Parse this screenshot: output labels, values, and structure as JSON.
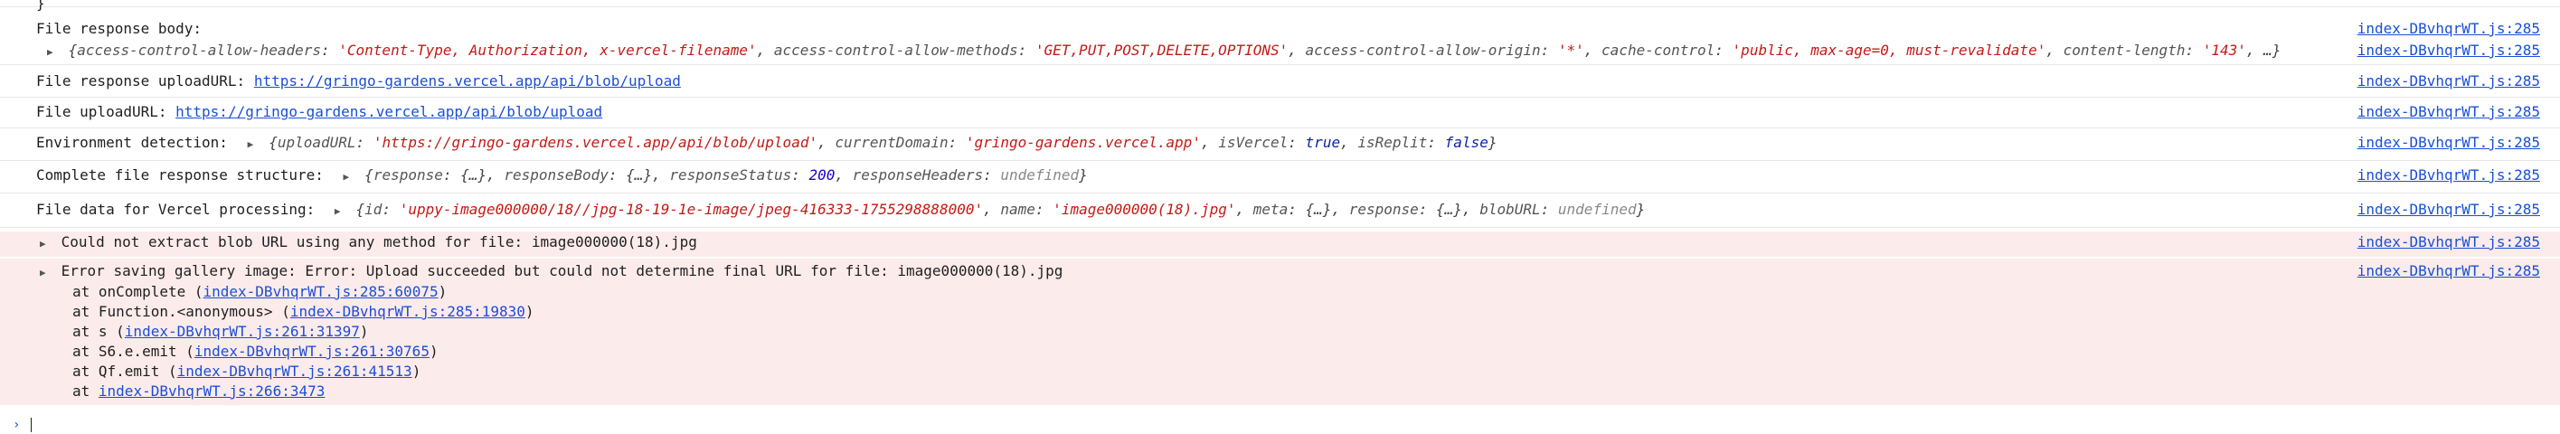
{
  "top_fragment": "}",
  "source_ref": "index-DBvhqrWT.js:285",
  "rows": {
    "file_response_body": {
      "label": "File response body:",
      "object": {
        "k1": "access-control-allow-headers",
        "v1": "'Content-Type, Authorization, x-vercel-filename'",
        "k2": "access-control-allow-methods",
        "v2": "'GET,PUT,POST,DELETE,OPTIONS'",
        "k3": "access-control-allow-origin",
        "v3": "'*'",
        "k4": "cache-control",
        "v4": "'public, max-age=0, must-revalidate'",
        "k5": "content-length",
        "v5": "'143'",
        "tail": ", …}"
      }
    },
    "file_response_upload_url": {
      "label": "File response uploadURL:",
      "url": "https://gringo-gardens.vercel.app/api/blob/upload"
    },
    "file_upload_url": {
      "label": "File uploadURL:",
      "url": "https://gringo-gardens.vercel.app/api/blob/upload"
    },
    "environment_detection": {
      "label": "Environment detection:",
      "k1": "uploadURL",
      "v1": "'https://gringo-gardens.vercel.app/api/blob/upload'",
      "k2": "currentDomain",
      "v2": "'gringo-gardens.vercel.app'",
      "k3": "isVercel",
      "v3": "true",
      "k4": "isReplit",
      "v4": "false"
    },
    "complete_structure": {
      "label": "Complete file response structure:",
      "k1": "response",
      "v1": "{…}",
      "k2": "responseBody",
      "v2": "{…}",
      "k3": "responseStatus",
      "v3": "200",
      "k4": "responseHeaders",
      "v4": "undefined"
    },
    "vercel_processing": {
      "label": "File data for Vercel processing:",
      "k1": "id",
      "v1": "'uppy-image000000/18//jpg-18-19-1e-image/jpeg-416333-1755298888000'",
      "k2": "name",
      "v2": "'image000000(18).jpg'",
      "k3": "meta",
      "v3": "{…}",
      "k4": "response",
      "v4": "{…}",
      "k5": "blobURL",
      "v5": "undefined"
    }
  },
  "errors": {
    "blob_url": "Could not extract blob URL using any method for file: image000000(18).jpg",
    "gallery": "Error saving gallery image: Error: Upload succeeded but could not determine final URL for file: image000000(18).jpg",
    "stack": [
      {
        "prefix": "at onComplete (",
        "link": "index-DBvhqrWT.js:285:60075",
        "suffix": ")"
      },
      {
        "prefix": "at Function.<anonymous> (",
        "link": "index-DBvhqrWT.js:285:19830",
        "suffix": ")"
      },
      {
        "prefix": "at s (",
        "link": "index-DBvhqrWT.js:261:31397",
        "suffix": ")"
      },
      {
        "prefix": "at S6.e.emit (",
        "link": "index-DBvhqrWT.js:261:30765",
        "suffix": ")"
      },
      {
        "prefix": "at Qf.emit (",
        "link": "index-DBvhqrWT.js:261:41513",
        "suffix": ")"
      },
      {
        "prefix": "at ",
        "link": "index-DBvhqrWT.js:266:3473",
        "suffix": ""
      }
    ]
  },
  "prompt_symbol": "›",
  "colors": {
    "error_bg": "#fcebeb",
    "error_icon": "#d93025",
    "link": "#1a4fd6",
    "string": "#c41a16",
    "number": "#1c00cf"
  }
}
